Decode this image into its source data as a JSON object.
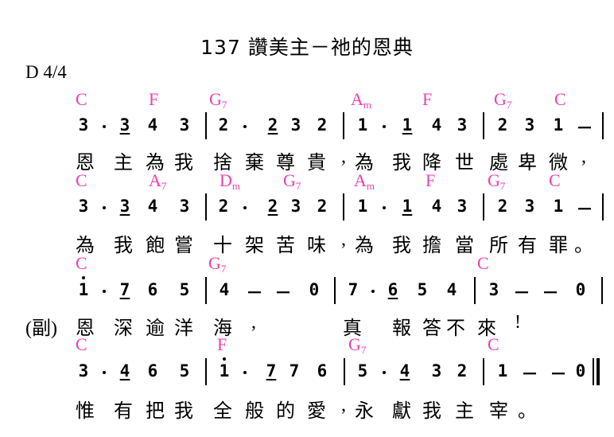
{
  "title": "137 讚美主－祂的恩典",
  "key_time": "D    4/4",
  "rows": [
    {
      "chords": [
        [
          "C",
          null
        ],
        [
          "F",
          null
        ],
        [
          "G",
          "7"
        ],
        [
          "A",
          "m"
        ],
        [
          "F",
          null
        ],
        [
          "G",
          "7"
        ],
        [
          "C",
          null
        ]
      ],
      "notes": [
        "3",
        "·",
        "3",
        "4",
        "3",
        "|",
        "2",
        "·",
        "2",
        "3",
        "2",
        "|",
        "1",
        "·",
        "1",
        "4",
        "3",
        "|",
        "2",
        "3",
        "1",
        "－",
        "|"
      ],
      "lyrics": [
        "恩",
        "主",
        "為",
        "我",
        "捨",
        "棄",
        "尊",
        "貴",
        ",",
        "為",
        "我",
        "降",
        "世",
        "處",
        "卑",
        "微",
        ","
      ]
    },
    {
      "chords": [
        [
          "C",
          null
        ],
        [
          "A",
          "7"
        ],
        [
          "D",
          "m"
        ],
        [
          "G",
          "7"
        ],
        [
          "A",
          "m"
        ],
        [
          "F",
          null
        ],
        [
          "G",
          "7"
        ],
        [
          "C",
          null
        ]
      ],
      "notes": [
        "3",
        "·",
        "3",
        "4",
        "3",
        "|",
        "2",
        "·",
        "2",
        "3",
        "2",
        "|",
        "1",
        "·",
        "1",
        "4",
        "3",
        "|",
        "2",
        "3",
        "1",
        "－",
        "|"
      ],
      "lyrics": [
        "為",
        "我",
        "飽",
        "嘗",
        "十",
        "架",
        "苦",
        "味",
        ",",
        "為",
        "我",
        "擔",
        "當",
        "所",
        "有",
        "罪",
        "。"
      ]
    },
    {
      "chords": [
        [
          "C",
          null
        ],
        [
          "G",
          "7"
        ],
        [
          "C",
          null
        ]
      ],
      "notes": [
        "1",
        "·",
        "7",
        "6",
        "5",
        "|",
        "4",
        "－",
        "－",
        "0",
        "|",
        "7",
        "·",
        "6",
        "5",
        "4",
        "|",
        "3",
        "－",
        "－",
        "0",
        "|"
      ],
      "prefix": "(副)",
      "lyrics": [
        "恩",
        "深",
        "逾",
        "洋",
        "海",
        ",",
        "真",
        "報",
        "答",
        "不",
        "來",
        "!"
      ]
    },
    {
      "chords": [
        [
          "C",
          null
        ],
        [
          "F",
          null
        ],
        [
          "G",
          "7"
        ],
        [
          "C",
          null
        ]
      ],
      "notes": [
        "3",
        "·",
        "4",
        "6",
        "5",
        "|",
        "1",
        "·",
        "7",
        "7",
        "6",
        "|",
        "5",
        "·",
        "4",
        "3",
        "2",
        "|",
        "1",
        "－",
        "－",
        "0",
        "||"
      ],
      "lyrics": [
        "惟",
        "有",
        "把",
        "我",
        "全",
        "般",
        "的",
        "愛",
        ",",
        "永",
        "獻",
        "我",
        "主",
        "宰",
        "。"
      ]
    }
  ]
}
